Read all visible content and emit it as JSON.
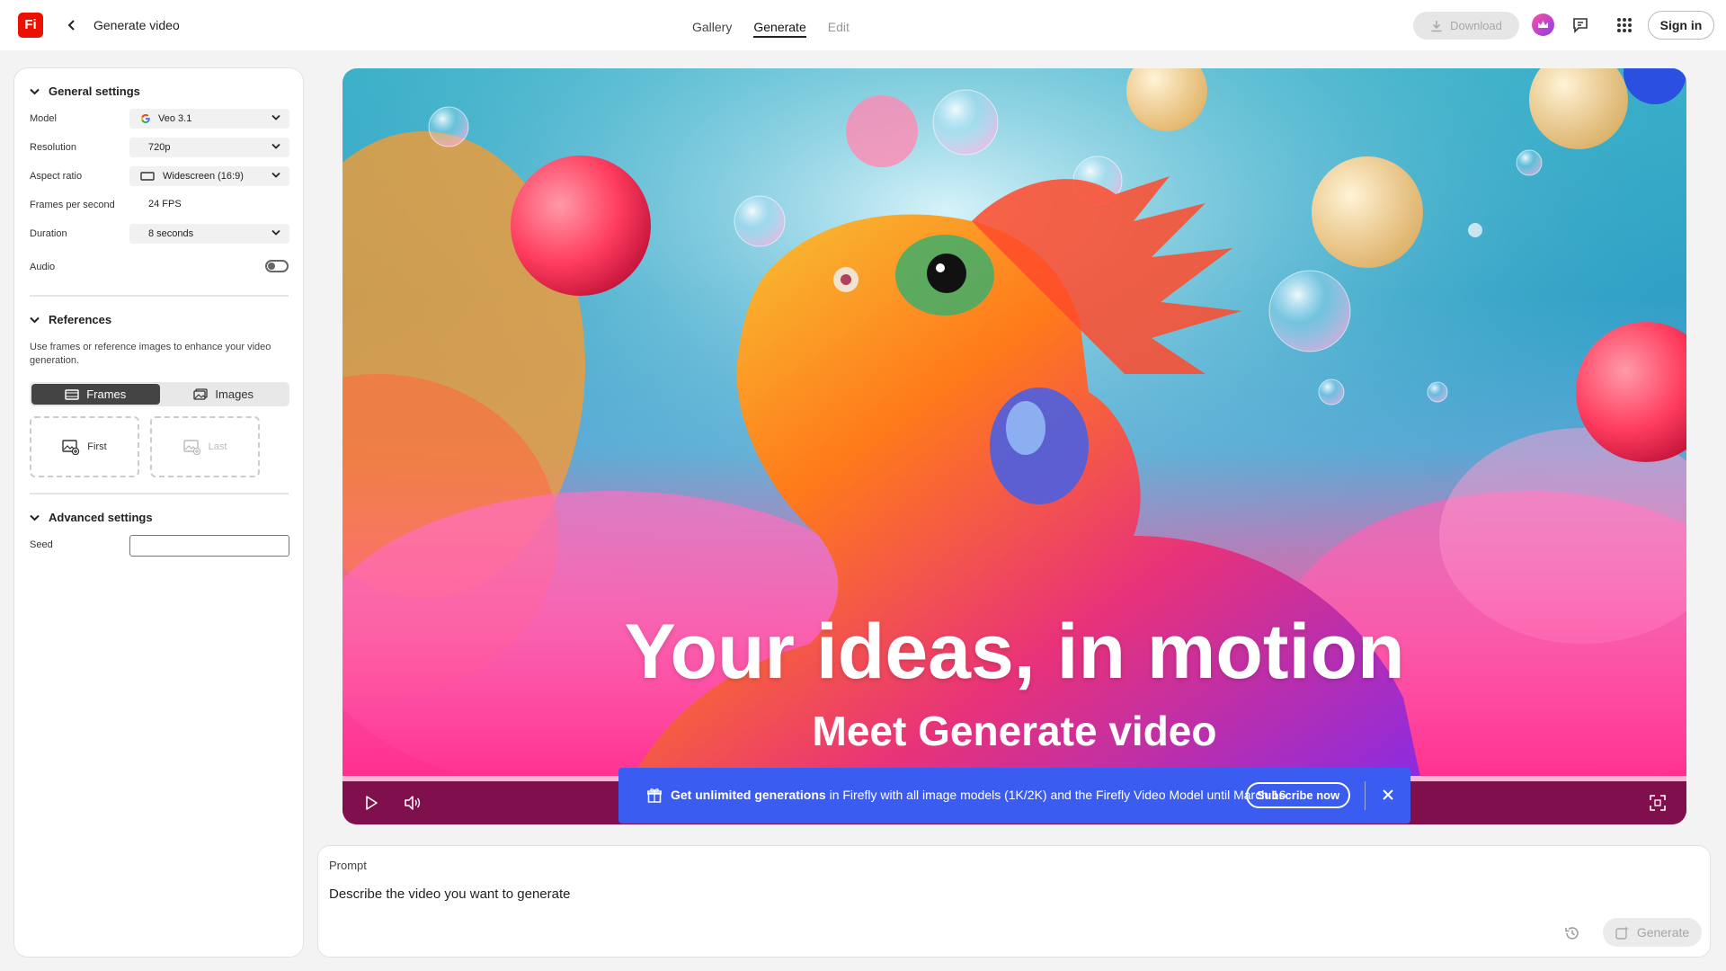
{
  "app": {
    "logo_text": "Fi",
    "page_title": "Generate video"
  },
  "nav": {
    "tabs": [
      "Gallery",
      "Generate",
      "Edit"
    ],
    "active": "Generate"
  },
  "header": {
    "download_label": "Download",
    "signin_label": "Sign in"
  },
  "general_settings": {
    "title": "General settings",
    "model_label": "Model",
    "model_value": "Veo 3.1",
    "resolution_label": "Resolution",
    "resolution_value": "720p",
    "aspect_label": "Aspect ratio",
    "aspect_value": "Widescreen (16:9)",
    "fps_label": "Frames per second",
    "fps_value": "24 FPS",
    "duration_label": "Duration",
    "duration_value": "8 seconds",
    "audio_label": "Audio",
    "audio_on": false
  },
  "references": {
    "title": "References",
    "description": "Use frames or reference images to enhance your video generation.",
    "tabs": [
      "Frames",
      "Images"
    ],
    "active_tab": "Frames",
    "first_label": "First",
    "last_label": "Last"
  },
  "advanced": {
    "title": "Advanced settings",
    "seed_label": "Seed",
    "seed_value": ""
  },
  "hero": {
    "title": "Your ideas, in motion",
    "subtitle": "Meet Generate video",
    "progress": 0.0
  },
  "banner": {
    "bold_text": "Get unlimited generations",
    "text": " in Firefly with all image models (1K/2K) and the Firefly Video Model until March 16.",
    "cta": "Subscribe now"
  },
  "prompt": {
    "label": "Prompt",
    "placeholder": "Describe the video you want to generate",
    "generate_label": "Generate"
  },
  "colors": {
    "brand": "#eb1000",
    "banner": "#3b5cf0",
    "controls": "#80104d"
  }
}
